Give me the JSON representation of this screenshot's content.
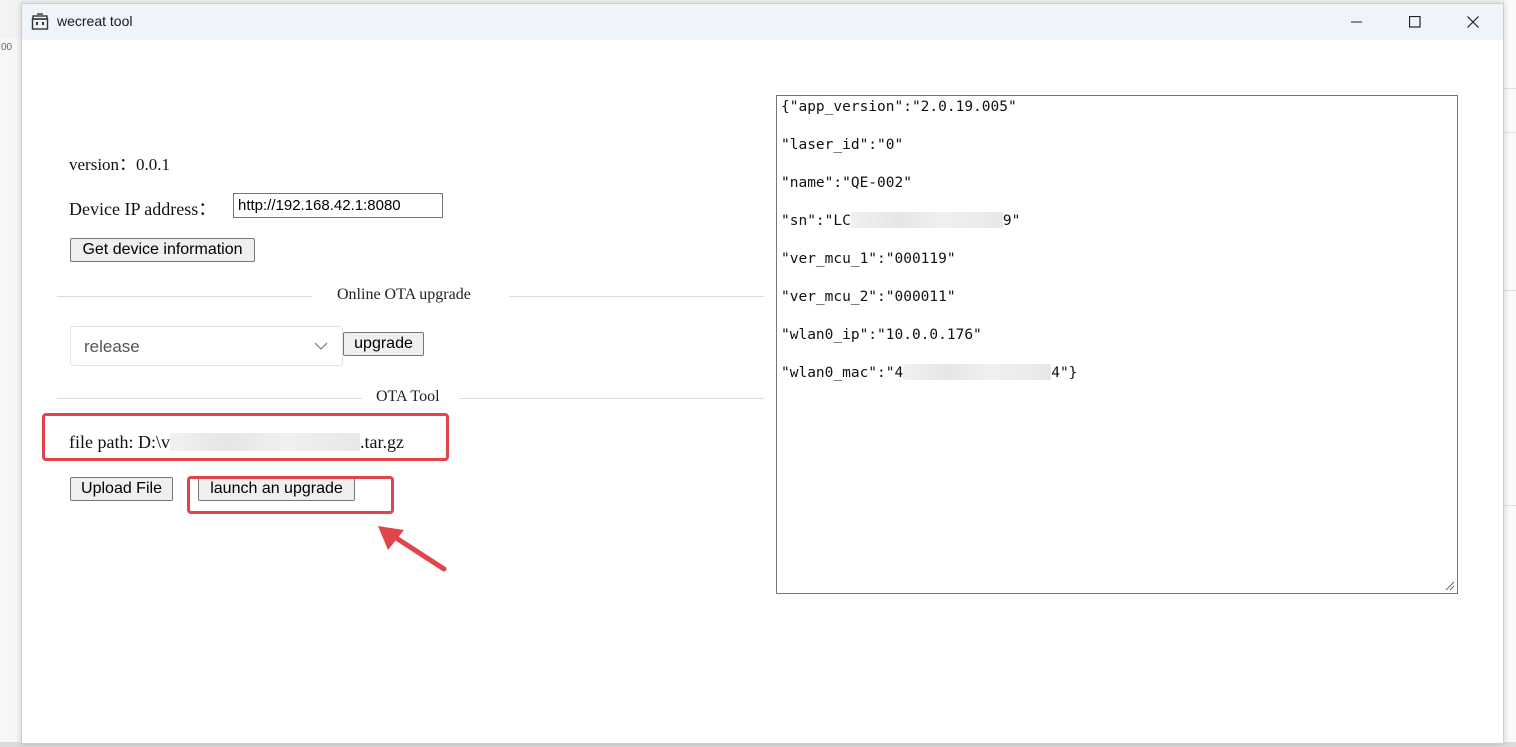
{
  "window": {
    "title": "wecreat tool"
  },
  "background": {
    "ruler_text": "00"
  },
  "device": {
    "version_label": "version：",
    "version_value": "0.0.1",
    "ip_label": "Device IP address：",
    "ip_value": "http://192.168.42.1:8080",
    "get_info_label": "Get device information"
  },
  "online_ota": {
    "section_title": "Online OTA upgrade",
    "channel_selected": "release",
    "upgrade_label": "upgrade"
  },
  "ota_tool": {
    "section_title": "OTA Tool",
    "file_path_prefix": "file path: D:\\v",
    "file_path_suffix": ".tar.gz",
    "upload_label": "Upload File",
    "launch_label": "launch an upgrade"
  },
  "device_info_output": {
    "lines": [
      "{\"app_version\":\"2.0.19.005\"",
      "\"laser_id\":\"0\"",
      "\"name\":\"QE-002\"",
      "\"sn\":\"LC",
      "\"ver_mcu_1\":\"000119\"",
      "\"ver_mcu_2\":\"000011\"",
      "\"wlan0_ip\":\"10.0.0.176\"",
      "\"wlan0_mac\":\"4"
    ],
    "sn_tail": "9\"",
    "mac_tail": "4\"}"
  },
  "colors": {
    "annotation": "#e0454b",
    "titlebar": "#eff4fa"
  }
}
